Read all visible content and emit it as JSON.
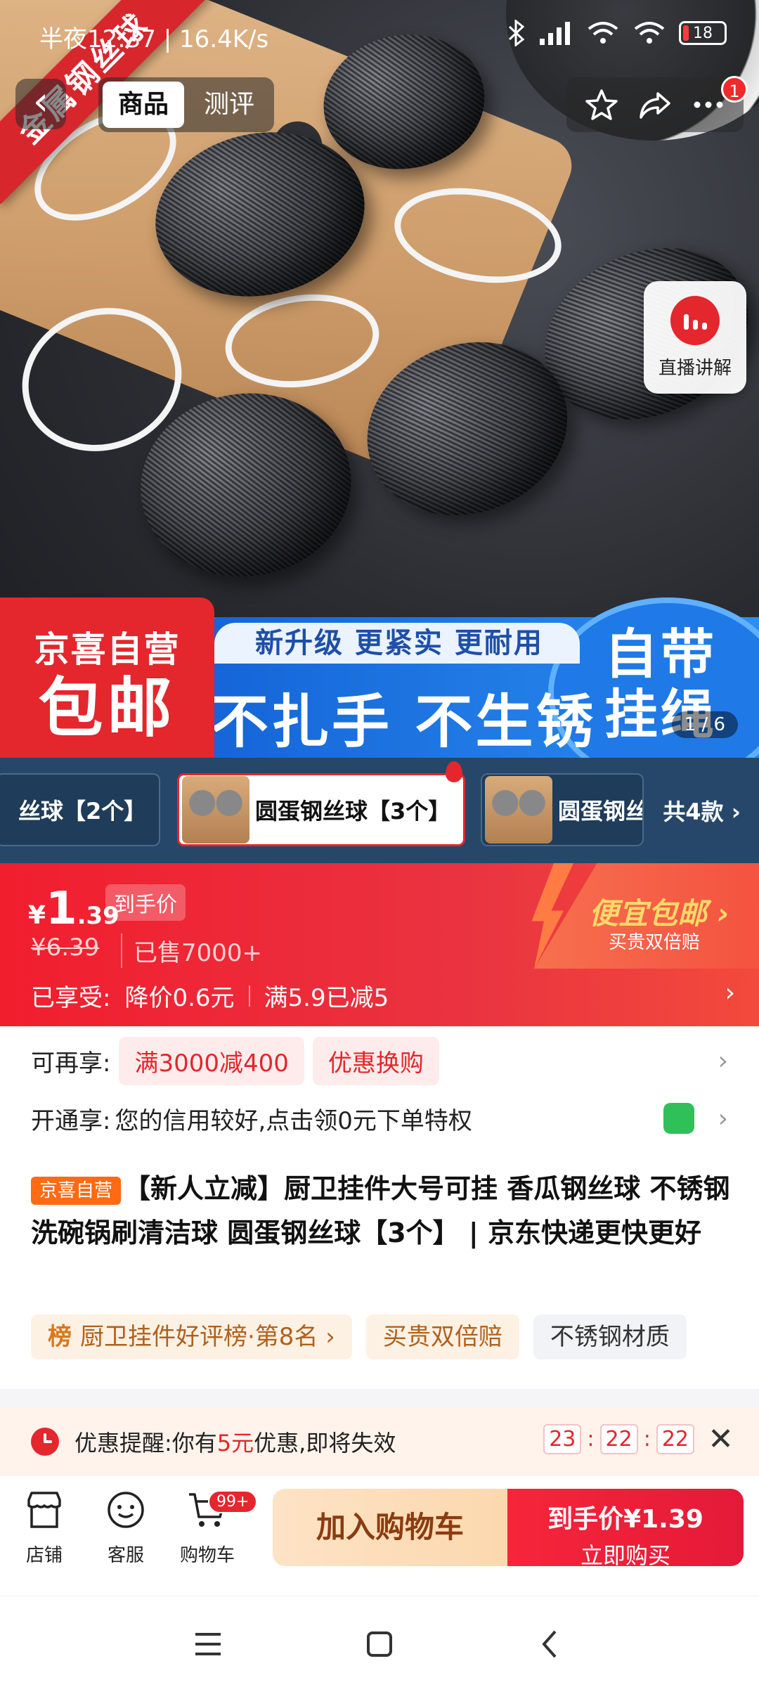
{
  "status_bar": {
    "time": "半夜12:37 | 16.4K/s",
    "battery": "18"
  },
  "nav": {
    "back_label": "‹",
    "tabs": [
      "商品",
      "测评"
    ],
    "notification_count": "1"
  },
  "hero": {
    "corner_ribbon": "金属钢丝球",
    "live_label": "直播讲解",
    "banner_left_top": "京喜自营",
    "banner_left_big": "包邮",
    "banner_strip": "新升级 更紧实 更耐用",
    "banner_big": "不扎手 不生锈",
    "banner_circle": "自带\n挂绳",
    "pager": "1 / 6"
  },
  "variants": {
    "items": [
      "丝球【2个】",
      "圆蛋钢丝球【3个】",
      "圆蛋钢丝"
    ],
    "selected_index": 1,
    "count_label": "共4款 ›"
  },
  "price": {
    "currency": "¥",
    "integer": "1",
    "decimal": ".39",
    "tag": "到手价",
    "original": "¥6.39",
    "sold": "已售7000+",
    "enjoyed_label": "已享受:",
    "enjoyed_items": [
      "降价0.6元",
      "满5.9已减5"
    ],
    "cheap_title": "便宜包邮 ›",
    "cheap_sub": "买贵双倍赔"
  },
  "promos": {
    "more_label": "可再享:",
    "more_pills": [
      "满3000减400",
      "优惠换购"
    ],
    "open_label": "开通享:",
    "open_text": "您的信用较好,点击领0元下单特权"
  },
  "product": {
    "store_tag": "京喜自营",
    "title": "【新人立减】厨卫挂件大号可挂 香瓜钢丝球 不锈钢洗碗锅刷清洁球 圆蛋钢丝球【3个】 | 京东快递更快更好",
    "chips": {
      "rank_icon": "榜",
      "rank_text": "厨卫挂件好评榜·第8名 ›",
      "warm": "买贵双倍赔",
      "gray": "不锈钢材质"
    }
  },
  "reminder": {
    "prefix": "优惠提醒:你有",
    "amount": "5元",
    "suffix": "优惠,即将失效",
    "countdown": [
      "23",
      "22",
      "22"
    ]
  },
  "action_bar": {
    "store": "店铺",
    "service": "客服",
    "cart": "购物车",
    "cart_badge": "99+",
    "add_to_cart": "加入购物车",
    "buy_line1": "到手价¥1.39",
    "buy_line2": "立即购买"
  },
  "colors": {
    "accent_red": "#e4262d",
    "cta_red": "#f6253a",
    "variant_bg": "#26476a"
  }
}
